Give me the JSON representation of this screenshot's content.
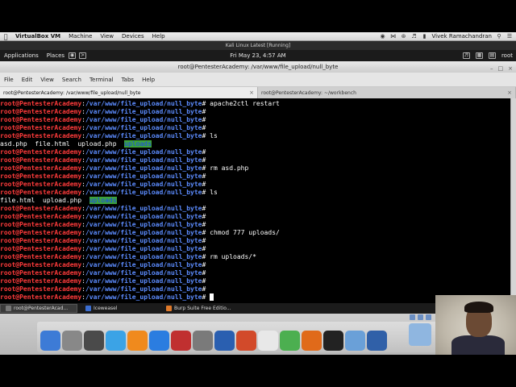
{
  "host_menubar": {
    "app": "VirtualBox VM",
    "items": [
      "Machine",
      "View",
      "Devices",
      "Help"
    ],
    "window_title": "Kali Linux Latest [Running]",
    "user": "Vivek Ramachandran"
  },
  "kali_panel": {
    "applications": "Applications",
    "places": "Places",
    "clock": "Fri May 23,  4:57 AM",
    "user": "root"
  },
  "terminal": {
    "title": "root@PentesterAcademy: /var/www/file_upload/null_byte",
    "menu": [
      "File",
      "Edit",
      "View",
      "Search",
      "Terminal",
      "Tabs",
      "Help"
    ],
    "tabs": [
      {
        "label": "root@PentesterAcademy: /var/www/file_upload/null_byte"
      },
      {
        "label": "root@PentesterAcademy: ~/workbench"
      }
    ],
    "prompt_user": "root@PentesterAcademy",
    "prompt_path": "/var/www/file_upload/null_byte",
    "lines": [
      {
        "cmd": "apache2ctl restart"
      },
      {
        "cmd": ""
      },
      {
        "cmd": ""
      },
      {
        "cmd": ""
      },
      {
        "cmd": "ls"
      },
      {
        "output": [
          "asd.php",
          "file.html",
          "upload.php"
        ],
        "dir": "uploads"
      },
      {
        "cmd": ""
      },
      {
        "cmd": ""
      },
      {
        "cmd": "rm asd.php"
      },
      {
        "cmd": ""
      },
      {
        "cmd": ""
      },
      {
        "cmd": "ls"
      },
      {
        "output": [
          "file.html",
          "upload.php"
        ],
        "dir": "uploads"
      },
      {
        "cmd": ""
      },
      {
        "cmd": ""
      },
      {
        "cmd": ""
      },
      {
        "cmd": "chmod 777 uploads/"
      },
      {
        "cmd": ""
      },
      {
        "cmd": ""
      },
      {
        "cmd": "rm uploads/*"
      },
      {
        "cmd": ""
      },
      {
        "cmd": ""
      },
      {
        "cmd": ""
      },
      {
        "cmd": ""
      },
      {
        "cmd": "",
        "cursor": true
      }
    ]
  },
  "taskbar": {
    "tasks": [
      {
        "label": "root@PentesterAcad...",
        "active": true
      },
      {
        "label": "Iceweasel",
        "active": false
      },
      {
        "label": "Burp Suite Free Editio...",
        "active": false
      }
    ]
  },
  "dock": {
    "icons": [
      "finder-icon",
      "system-prefs-icon",
      "photo-icon",
      "itunes-icon",
      "vlc-icon",
      "app-store-icon",
      "preview-icon",
      "settings-icon",
      "word-icon",
      "powerpoint-icon",
      "textedit-icon",
      "chrome-icon",
      "firefox-icon",
      "terminal-icon",
      "screenshot-icon",
      "virtualbox-icon"
    ],
    "colors": [
      "#3d7bd6",
      "#888888",
      "#4a4a4a",
      "#3ba3e6",
      "#f08a1d",
      "#2b7de0",
      "#c03030",
      "#7a7a7a",
      "#2a5fb0",
      "#d24a2a",
      "#e8e8e8",
      "#4caf50",
      "#e06a1a",
      "#222222",
      "#6aa0d8",
      "#3060a8"
    ]
  }
}
